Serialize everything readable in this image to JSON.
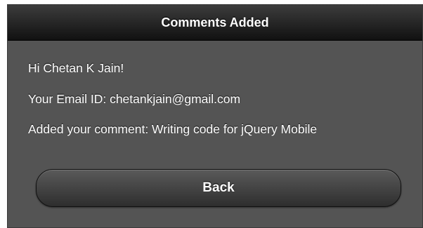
{
  "header": {
    "title": "Comments Added"
  },
  "content": {
    "greeting": "Hi Chetan K Jain!",
    "email_line": "Your Email ID: chetankjain@gmail.com",
    "comment_line": "Added your comment: Writing code for jQuery Mobile"
  },
  "actions": {
    "back_label": "Back"
  },
  "colors": {
    "header_background": "#1e1e1e",
    "page_background": "#545454",
    "text": "#ffffff"
  }
}
